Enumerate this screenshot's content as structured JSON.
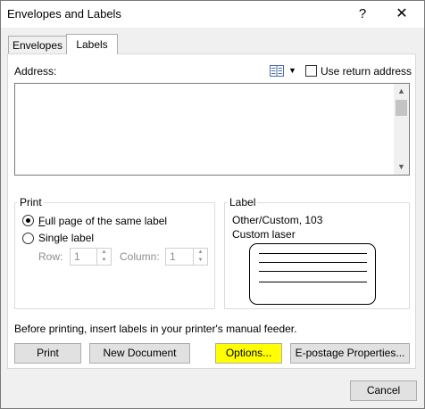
{
  "window": {
    "title": "Envelopes and Labels",
    "help_glyph": "?",
    "close_glyph": "✕"
  },
  "tabs": [
    {
      "label": "Envelopes",
      "active": false
    },
    {
      "label": "Labels",
      "active": true
    }
  ],
  "address": {
    "label": "Address:",
    "value": "",
    "use_return_address_label": "Use return address",
    "use_return_address_checked": false
  },
  "print_group": {
    "title": "Print",
    "full_page_label": "Full page of the same label",
    "single_label": "Single label",
    "selected": "full_page",
    "row_label": "Row:",
    "row_value": "1",
    "column_label": "Column:",
    "column_value": "1"
  },
  "label_group": {
    "title": "Label",
    "line1": "Other/Custom, 103",
    "line2": "Custom laser"
  },
  "info_text": "Before printing, insert labels in your printer's manual feeder.",
  "buttons": {
    "print": "Print",
    "new_document": "New Document",
    "options": "Options...",
    "epostage": "E-postage Properties...",
    "cancel": "Cancel"
  },
  "colors": {
    "highlight": "#ffff00",
    "dialog_bg": "#f0f0f0",
    "button_bg": "#e1e1e1"
  }
}
